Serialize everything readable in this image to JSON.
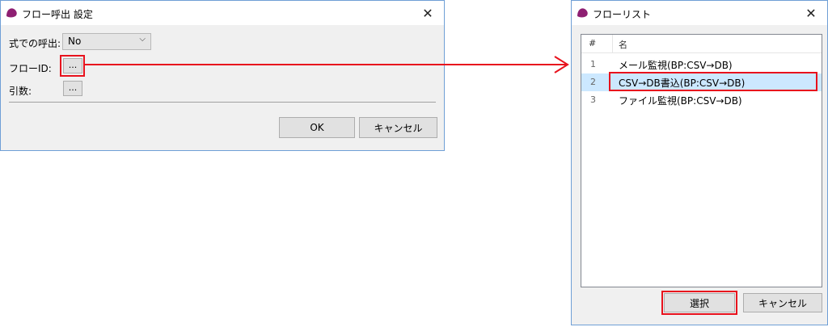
{
  "dialog1": {
    "title": "フロー呼出 設定",
    "close_glyph": "✕",
    "expr_label": "式での呼出:",
    "expr_value": "No",
    "flow_id_label": "フローID:",
    "args_label": "引数:",
    "browse_glyph": "...",
    "ok_label": "OK",
    "cancel_label": "キャンセル"
  },
  "dialog2": {
    "title": "フローリスト",
    "close_glyph": "✕",
    "col_num": "#",
    "col_name": "名",
    "rows": [
      {
        "num": "1",
        "name": "メール監視(BP:CSV→DB)"
      },
      {
        "num": "2",
        "name": "CSV→DB書込(BP:CSV→DB)"
      },
      {
        "num": "3",
        "name": "ファイル監視(BP:CSV→DB)"
      }
    ],
    "selected_row": "2",
    "select_label": "選択",
    "cancel_label": "キャンセル"
  },
  "colors": {
    "highlight_red": "#e8121d",
    "selection": "#cce8ff",
    "window_border": "#6f9fd6",
    "app_icon": "#8e1f72"
  },
  "icons": [
    "app-logo-icon",
    "close-icon",
    "chevron-down-icon",
    "arrow-connector"
  ]
}
